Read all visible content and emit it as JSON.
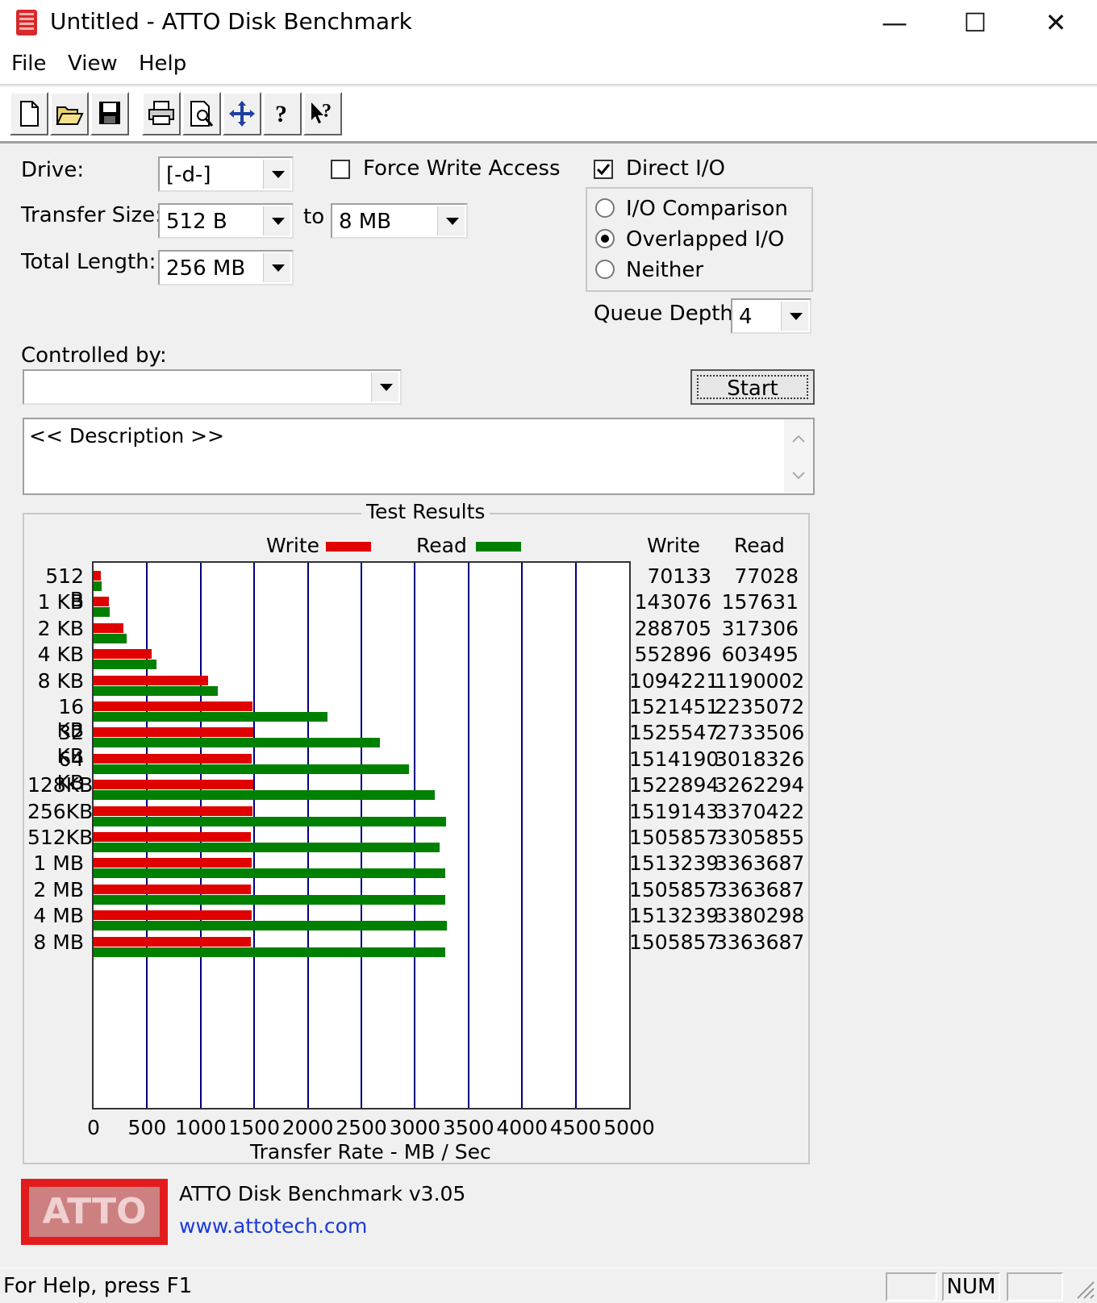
{
  "window": {
    "title": "Untitled - ATTO Disk Benchmark",
    "minimize_glyph": "—",
    "maximize_glyph": "☐",
    "close_glyph": "✕"
  },
  "menu": [
    "File",
    "View",
    "Help"
  ],
  "toolbar_icons": [
    "new-icon",
    "open-icon",
    "save-icon",
    "print-icon",
    "print-preview-icon",
    "move-icon",
    "help-icon",
    "context-help-icon"
  ],
  "form": {
    "drive_label": "Drive:",
    "drive_value": "[-d-]",
    "transfer_label": "Transfer Size:",
    "transfer_from": "512 B",
    "to_label": "to",
    "transfer_to": "8 MB",
    "total_label": "Total Length:",
    "total_value": "256 MB",
    "force_write_label": "Force Write Access",
    "force_write_checked": false,
    "direct_io_label": "Direct I/O",
    "direct_io_checked": true,
    "radio_io_comparison": "I/O Comparison",
    "radio_overlapped": "Overlapped I/O",
    "radio_neither": "Neither",
    "radio_selected": "Overlapped I/O",
    "queue_label": "Queue Depth:",
    "queue_value": "4",
    "controlled_label": "Controlled by:",
    "controlled_value": "",
    "start_label": "Start",
    "description": "<< Description >>"
  },
  "results": {
    "group_title": "Test Results",
    "write_legend": "Write",
    "read_legend": "Read",
    "col_write": "Write",
    "col_read": "Read"
  },
  "chart_data": {
    "type": "bar",
    "orientation": "horizontal",
    "categories": [
      "512 B",
      "1 KB",
      "2 KB",
      "4 KB",
      "8 KB",
      "16 KB",
      "32 KB",
      "64 KB",
      "128KB",
      "256KB",
      "512KB",
      "1 MB",
      "2 MB",
      "4 MB",
      "8 MB"
    ],
    "series": [
      {
        "name": "Write",
        "color": "#e00000",
        "values": [
          70133,
          143076,
          288705,
          552896,
          1094221,
          1521451,
          1525547,
          1514190,
          1522894,
          1519143,
          1505857,
          1513239,
          1505857,
          1513239,
          1505857
        ]
      },
      {
        "name": "Read",
        "color": "#008000",
        "values": [
          77028,
          157631,
          317306,
          603495,
          1190002,
          2235072,
          2733506,
          3018326,
          3262294,
          3370422,
          3305855,
          3363687,
          3363687,
          3380298,
          3363687
        ]
      }
    ],
    "x_ticks": [
      "0",
      "500",
      "1000",
      "1500",
      "2000",
      "2500",
      "3000",
      "3500",
      "4000",
      "4500",
      "5000"
    ],
    "xlim": [
      0,
      5000
    ],
    "xlabel": "Transfer Rate - MB / Sec",
    "grid": true
  },
  "footer": {
    "logo_text": "ATTO",
    "product": "ATTO Disk Benchmark v3.05",
    "url": "www.attotech.com"
  },
  "status": {
    "help_text": "For Help, press F1",
    "num": "NUM"
  }
}
